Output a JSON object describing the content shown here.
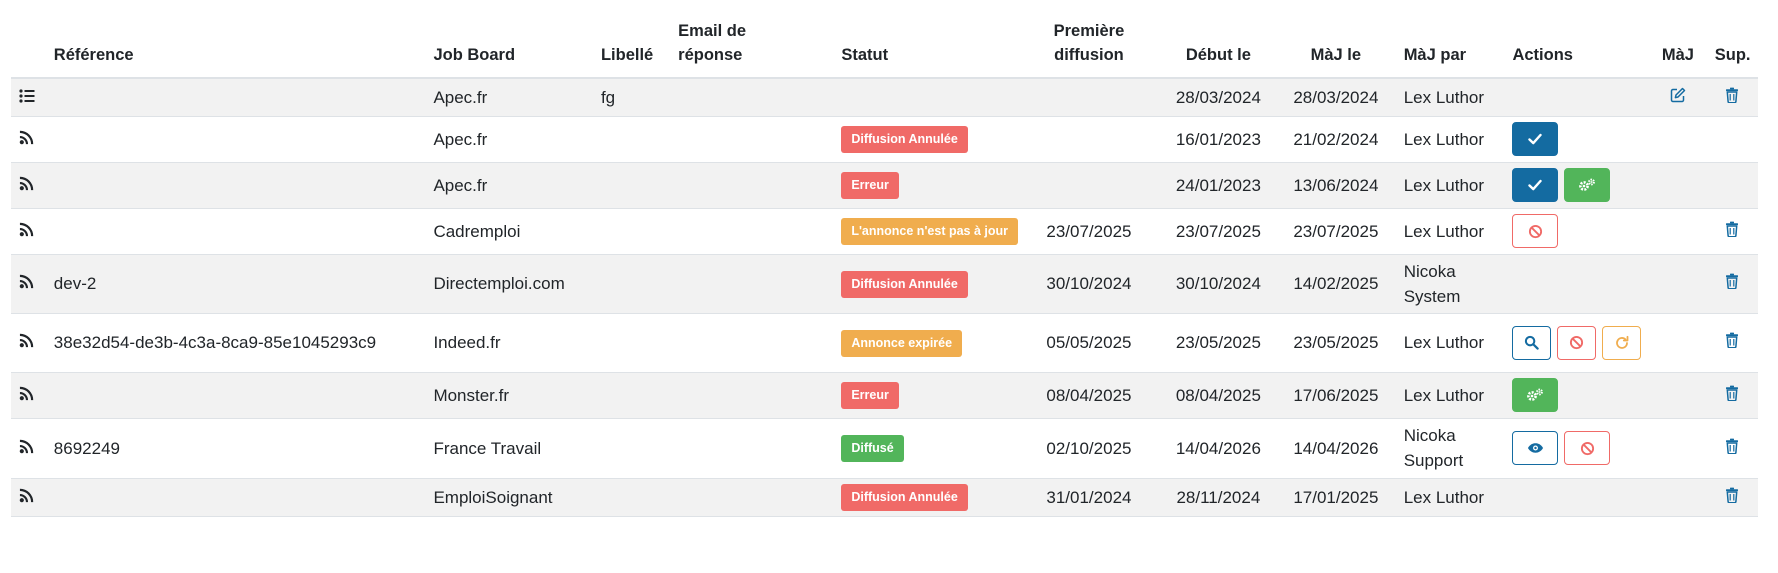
{
  "colors": {
    "badge": {
      "danger": "#f06a67",
      "warning": "#f0ad4e",
      "success": "#52b55a"
    },
    "primary": "#146ba1",
    "success": "#52b55a",
    "danger": "#f06a67",
    "warning": "#f0ad4e",
    "stripe": "#f2f2f2"
  },
  "headers": {
    "reference": "Référence",
    "job_board": "Job Board",
    "libelle": "Libellé",
    "email_l1": "Email de",
    "email_l2": "réponse",
    "statut": "Statut",
    "premiere_l1": "Première",
    "premiere_l2": "diffusion",
    "debut": "Début le",
    "maj_le": "MàJ le",
    "maj_par": "MàJ par",
    "actions": "Actions",
    "maj": "MàJ",
    "sup": "Sup."
  },
  "rows": [
    {
      "icon": "list-icon",
      "reference": "",
      "job_board": "Apec.fr",
      "libelle": "fg",
      "email": "",
      "status": "",
      "status_color": "",
      "premiere": "",
      "debut": "28/03/2024",
      "maj_le": "28/03/2024",
      "maj_par": "Lex Luthor",
      "actions": [],
      "edit": true,
      "delete": true
    },
    {
      "icon": "rss-icon",
      "reference": "",
      "job_board": "Apec.fr",
      "libelle": "",
      "email": "",
      "status": "Diffusion Annulée",
      "status_color": "danger",
      "premiere": "",
      "debut": "16/01/2023",
      "maj_le": "21/02/2024",
      "maj_par": "Lex Luthor",
      "actions": [
        "confirm"
      ],
      "edit": false,
      "delete": false
    },
    {
      "icon": "rss-icon",
      "reference": "",
      "job_board": "Apec.fr",
      "libelle": "",
      "email": "",
      "status": "Erreur",
      "status_color": "danger",
      "premiere": "",
      "debut": "24/01/2023",
      "maj_le": "13/06/2024",
      "maj_par": "Lex Luthor",
      "actions": [
        "confirm",
        "settings"
      ],
      "edit": false,
      "delete": false
    },
    {
      "icon": "rss-icon",
      "reference": "",
      "job_board": "Cadremploi",
      "libelle": "",
      "email": "",
      "status": "L'annonce n'est pas à jour",
      "status_color": "warning",
      "premiere": "23/07/2025",
      "debut": "23/07/2025",
      "maj_le": "23/07/2025",
      "maj_par": "Lex Luthor",
      "actions": [
        "cancel"
      ],
      "edit": false,
      "delete": true
    },
    {
      "icon": "rss-icon",
      "reference": "dev-2",
      "job_board": "Directemploi.com",
      "libelle": "",
      "email": "",
      "status": "Diffusion Annulée",
      "status_color": "danger",
      "premiere": "30/10/2024",
      "debut": "30/10/2024",
      "maj_le": "14/02/2025",
      "maj_par": "Nicoka System",
      "actions": [],
      "edit": false,
      "delete": true
    },
    {
      "icon": "rss-icon",
      "reference": "38e32d54-de3b-4c3a-8ca9-85e1045293c9",
      "job_board": "Indeed.fr",
      "libelle": "",
      "email": "",
      "status": "Annonce expirée",
      "status_color": "warning",
      "premiere": "05/05/2025",
      "debut": "23/05/2025",
      "maj_le": "23/05/2025",
      "maj_par": "Lex Luthor",
      "actions": [
        "search",
        "cancel",
        "refresh"
      ],
      "edit": false,
      "delete": true
    },
    {
      "icon": "rss-icon",
      "reference": "",
      "job_board": "Monster.fr",
      "libelle": "",
      "email": "",
      "status": "Erreur",
      "status_color": "danger",
      "premiere": "08/04/2025",
      "debut": "08/04/2025",
      "maj_le": "17/06/2025",
      "maj_par": "Lex Luthor",
      "actions": [
        "settings"
      ],
      "edit": false,
      "delete": true
    },
    {
      "icon": "rss-icon",
      "reference": "8692249",
      "job_board": "France Travail",
      "libelle": "",
      "email": "",
      "status": "Diffusé",
      "status_color": "success",
      "premiere": "02/10/2025",
      "debut": "14/04/2026",
      "maj_le": "14/04/2026",
      "maj_par": "Nicoka Support",
      "actions": [
        "view",
        "cancel"
      ],
      "edit": false,
      "delete": true
    },
    {
      "icon": "rss-icon",
      "reference": "",
      "job_board": "EmploiSoignant",
      "libelle": "",
      "email": "",
      "status": "Diffusion Annulée",
      "status_color": "danger",
      "premiere": "31/01/2024",
      "debut": "28/11/2024",
      "maj_le": "17/01/2025",
      "maj_par": "Lex Luthor",
      "actions": [],
      "edit": false,
      "delete": true
    }
  ]
}
